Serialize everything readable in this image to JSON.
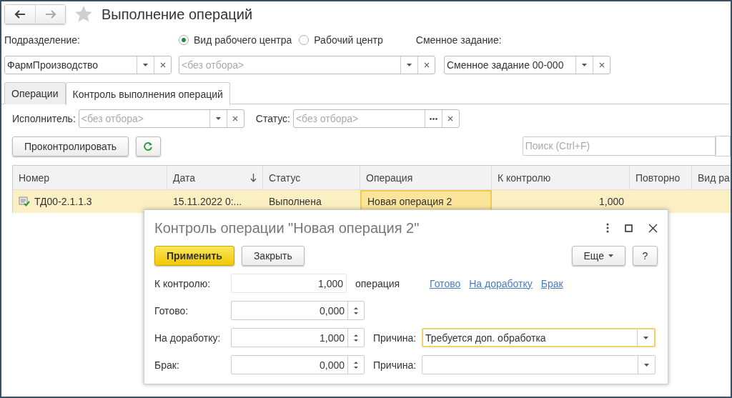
{
  "window": {
    "title": "Выполнение операций",
    "favorite": false
  },
  "filters": {
    "subdivision_label": "Подразделение:",
    "subdivision_value": "ФармПроизводство",
    "mode_options": [
      {
        "label": "Вид рабочего центра",
        "selected": true
      },
      {
        "label": "Рабочий центр",
        "selected": false
      }
    ],
    "work_center_placeholder": "<без отбора>",
    "shift_task_label": "Сменное задание:",
    "shift_task_value": "Сменное задание 00-000"
  },
  "tabs": [
    {
      "label": "Операции",
      "selected": false
    },
    {
      "label": "Контроль выполнения операций",
      "selected": true
    }
  ],
  "control": {
    "executor_label": "Исполнитель:",
    "executor_placeholder": "<без отбора>",
    "status_label": "Статус:",
    "status_placeholder": "<без отбора>",
    "check_button": "Проконтролировать",
    "search_placeholder": "Поиск (Ctrl+F)"
  },
  "table": {
    "columns": [
      {
        "label": "Номер",
        "sorted": false
      },
      {
        "label": "Дата",
        "sorted": true
      },
      {
        "label": "Статус",
        "sorted": false
      },
      {
        "label": "Операция",
        "sorted": false
      },
      {
        "label": "К контролю",
        "sorted": false
      },
      {
        "label": "Повторно",
        "sorted": false
      },
      {
        "label": "Вид ра"
      }
    ],
    "rows": [
      {
        "selected": true,
        "cells": [
          "ТД00-2.1.1.3",
          "15.11.2022 0:...",
          "Выполнена",
          "Новая операция 2",
          "1,000"
        ]
      }
    ]
  },
  "dialog": {
    "title": "Контроль операции \"Новая операция 2\"",
    "apply_button": "Применить",
    "close_button": "Закрыть",
    "more_button": "Еще",
    "help_button": "?",
    "to_control_label": "К контролю:",
    "to_control_value": "1,000",
    "unit": "операция",
    "links": [
      "Готово",
      "На доработку",
      "Брак"
    ],
    "rows": [
      {
        "label": "Готово:",
        "value": "0,000"
      },
      {
        "label": "На доработку:",
        "value": "1,000",
        "reason_label": "Причина:",
        "reason_value": "Требуется доп. обработка",
        "reason_focused": true
      },
      {
        "label": "Брак:",
        "value": "0,000",
        "reason_label": "Причина:",
        "reason_focused": false
      }
    ]
  }
}
